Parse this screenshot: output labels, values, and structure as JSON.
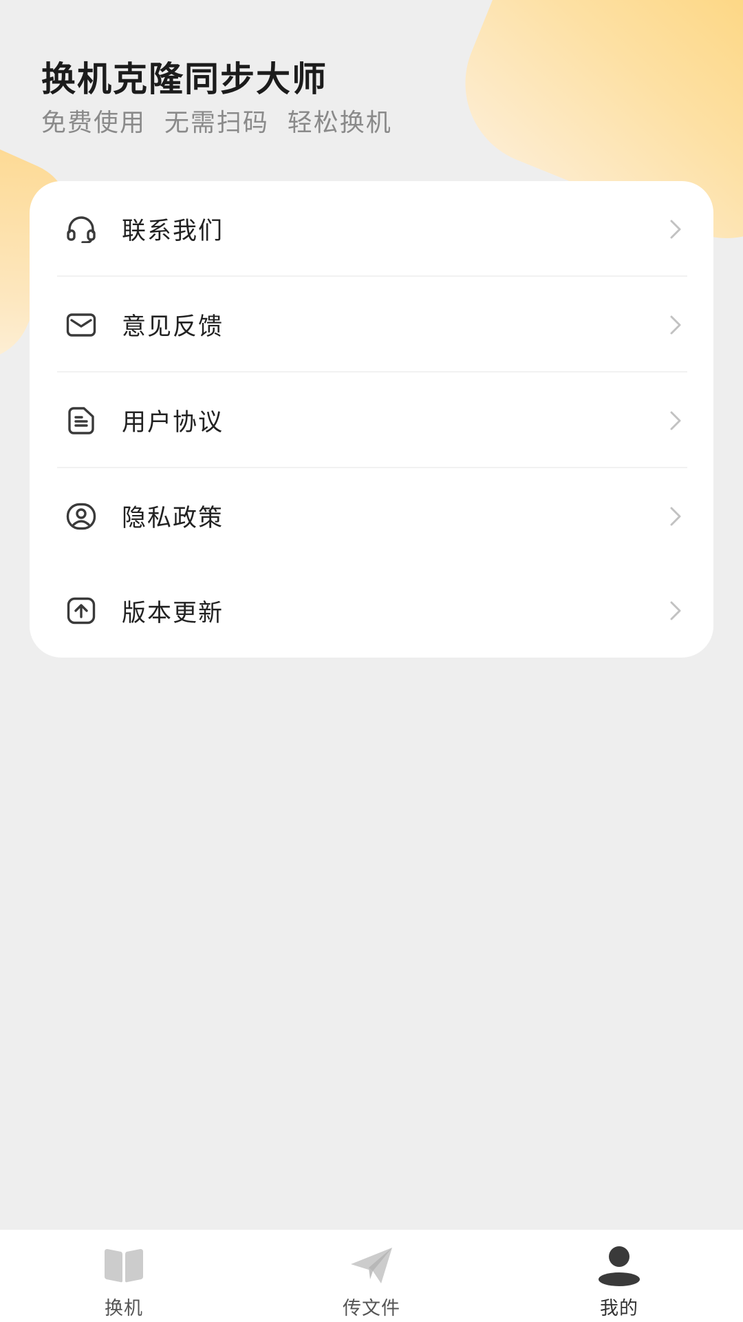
{
  "header": {
    "title": "换机克隆同步大师",
    "subtitle": "免费使用  无需扫码  轻松换机"
  },
  "menu": {
    "items": [
      {
        "label": "联系我们",
        "icon": "headset-icon"
      },
      {
        "label": "意见反馈",
        "icon": "mail-icon"
      },
      {
        "label": "用户协议",
        "icon": "document-icon"
      },
      {
        "label": "隐私政策",
        "icon": "user-shield-icon"
      },
      {
        "label": "版本更新",
        "icon": "upload-icon"
      }
    ]
  },
  "tabbar": {
    "tabs": [
      {
        "label": "换机",
        "icon": "book-icon",
        "active": false
      },
      {
        "label": "传文件",
        "icon": "paper-plane-icon",
        "active": false
      },
      {
        "label": "我的",
        "icon": "user-icon",
        "active": true
      }
    ]
  },
  "colors": {
    "background": "#eeeeee",
    "accent_gradient_start": "#fdd16f",
    "accent_gradient_end": "#fdeed6",
    "card": "#ffffff",
    "text_primary": "#222222",
    "text_secondary": "#8a8a8a",
    "icon_inactive": "#cccccc",
    "icon_active": "#3a3a3a"
  }
}
